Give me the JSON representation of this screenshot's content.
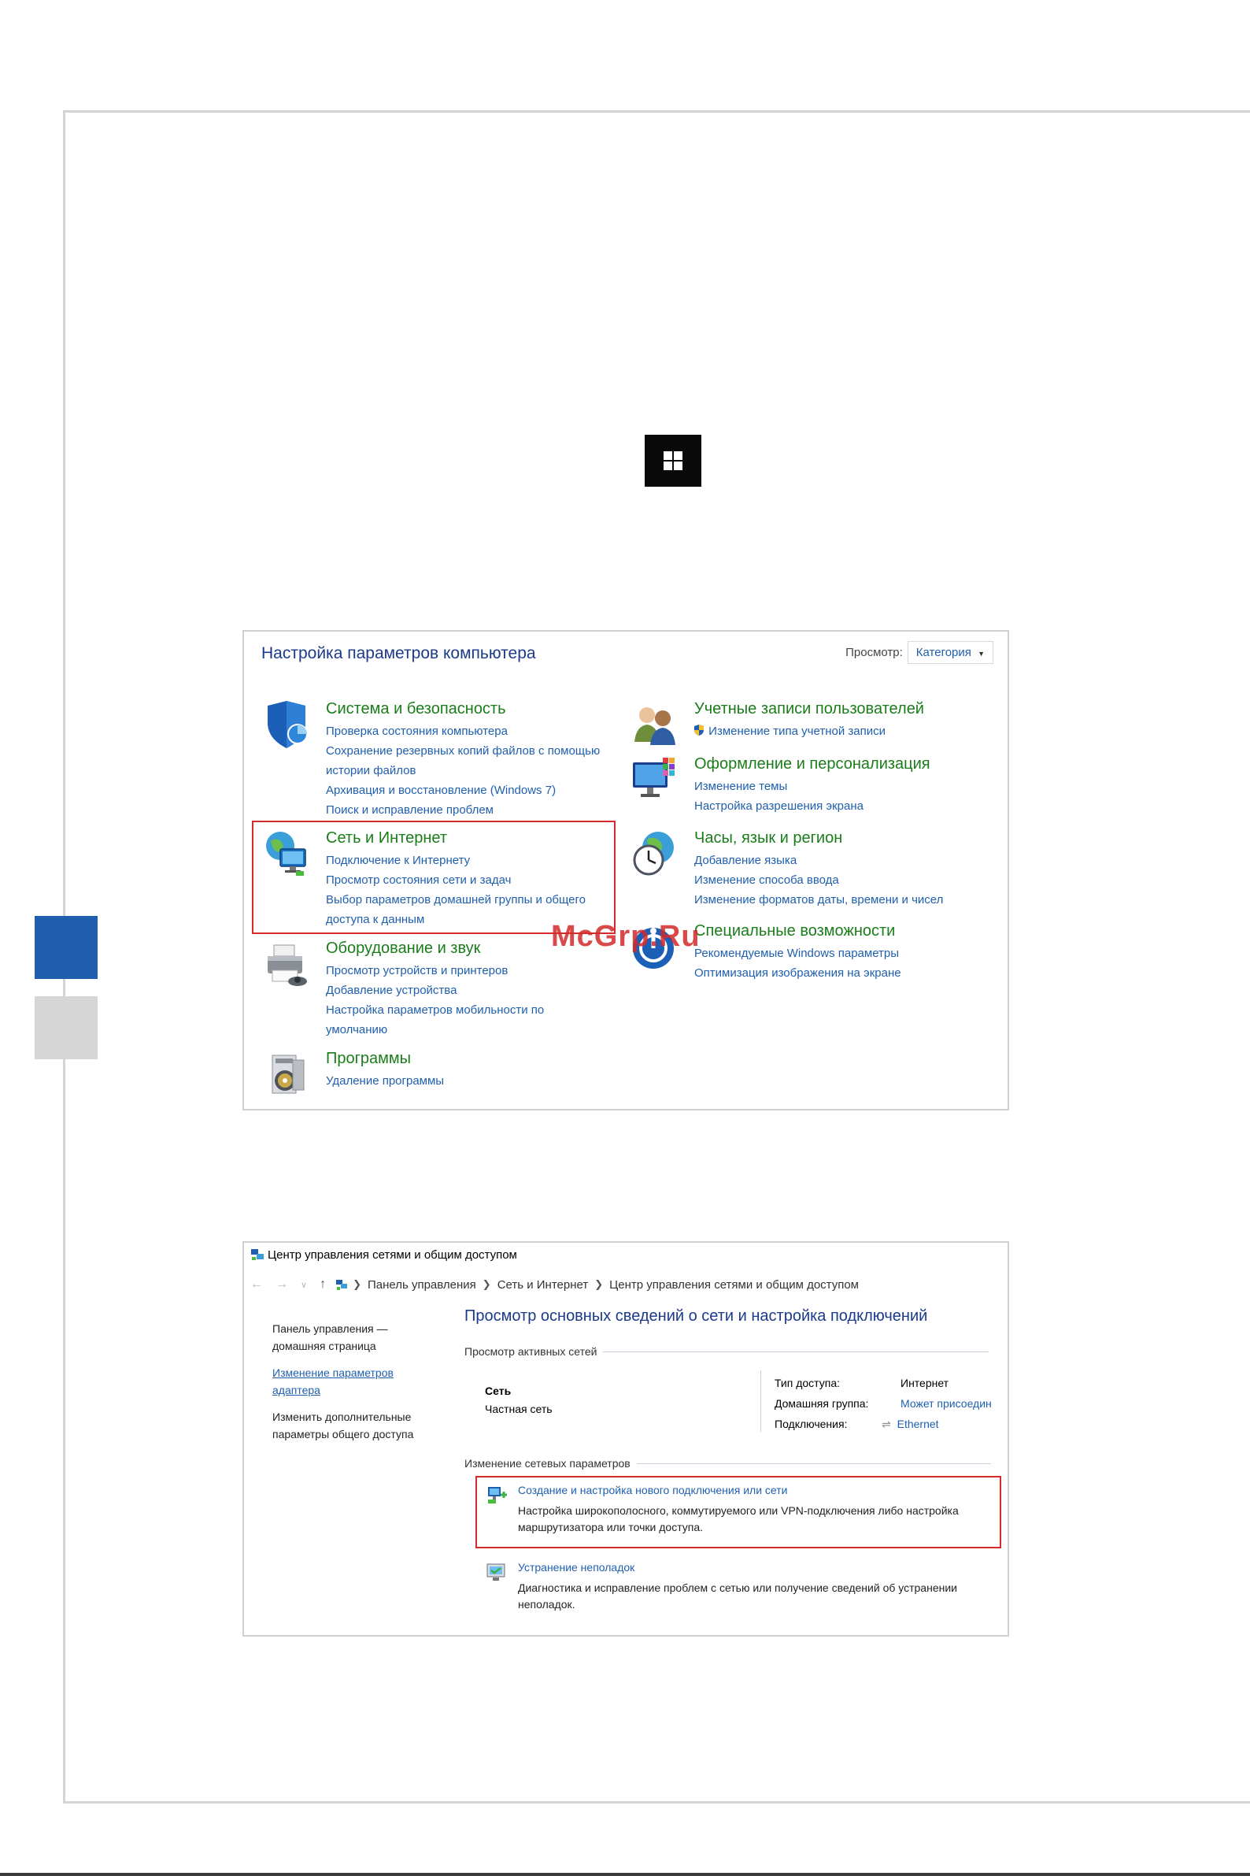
{
  "control_panel": {
    "title": "Настройка параметров компьютера",
    "view_label": "Просмотр:",
    "view_value": "Категория",
    "categories_left": [
      {
        "title": "Система и безопасность",
        "icon": "shield-icon",
        "links": [
          "Проверка состояния компьютера",
          "Сохранение резервных копий файлов с помощью",
          "истории файлов",
          "Архивация и восстановление (Windows 7)",
          "Поиск и исправление проблем"
        ]
      },
      {
        "title": "Сеть и Интернет",
        "icon": "network-icon",
        "links": [
          "Подключение к Интернету",
          "Просмотр состояния сети и задач",
          "Выбор параметров домашней группы и общего",
          "доступа к данным"
        ]
      },
      {
        "title": "Оборудование и звук",
        "icon": "printer-icon",
        "links": [
          "Просмотр устройств и принтеров",
          "Добавление устройства",
          "Настройка параметров мобильности по",
          "умолчанию"
        ]
      },
      {
        "title": "Программы",
        "icon": "programs-icon",
        "links": [
          "Удаление программы"
        ]
      }
    ],
    "categories_right": [
      {
        "title": "Учетные записи пользователей",
        "icon": "users-icon",
        "links": [
          "Изменение типа учетной записи"
        ]
      },
      {
        "title": "Оформление и персонализация",
        "icon": "personalization-icon",
        "links": [
          "Изменение темы",
          "Настройка разрешения экрана"
        ]
      },
      {
        "title": "Часы, язык и регион",
        "icon": "clock-globe-icon",
        "links": [
          "Добавление языка",
          "Изменение способа ввода",
          "Изменение форматов даты, времени и чисел"
        ]
      },
      {
        "title": "Специальные возможности",
        "icon": "accessibility-icon",
        "links": [
          "Рекомендуемые Windows параметры",
          "Оптимизация изображения на экране"
        ]
      }
    ]
  },
  "watermark": "McGrp.Ru",
  "network_center": {
    "window_title": "Центр управления сетями и общим доступом",
    "breadcrumb": [
      "Панель управления",
      "Сеть и Интернет",
      "Центр управления сетями и общим доступом"
    ],
    "sidebar": {
      "home": "Панель управления — домашняя страница",
      "adapter": "Изменение параметров адаптера",
      "sharing": "Изменить дополнительные параметры общего доступа"
    },
    "heading": "Просмотр основных сведений о сети и настройка подключений",
    "active_networks_label": "Просмотр активных сетей",
    "network_name": "Сеть",
    "network_type": "Частная сеть",
    "access_type_label": "Тип доступа:",
    "access_type_value": "Интернет",
    "homegroup_label": "Домашняя группа:",
    "homegroup_value": "Может присоедин",
    "connections_label": "Подключения:",
    "connections_value": "Ethernet",
    "change_settings_label": "Изменение сетевых параметров",
    "task1_title": "Создание и настройка нового подключения или сети",
    "task1_desc": "Настройка широкополосного, коммутируемого или VPN-подключения либо настройка маршрутизатора или точки доступа.",
    "task2_title": "Устранение неполадок",
    "task2_desc": "Диагностика и исправление проблем с сетью или получение сведений об устранении неполадок."
  }
}
